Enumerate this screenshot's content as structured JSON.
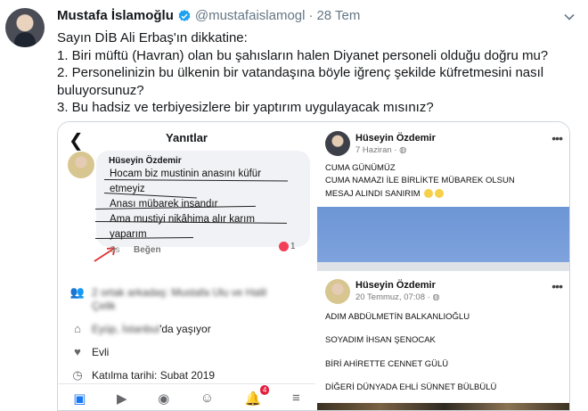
{
  "tweet": {
    "author_name": "Mustafa İslamoğlu",
    "handle": "@mustafaislamogl",
    "separator": "·",
    "date": "28 Tem",
    "lines": [
      "Sayın DİB Ali Erbaş'ın dikkatine:",
      "1. Biri müftü (Havran) olan bu şahısların halen Diyanet personeli olduğu doğru mu?",
      "2. Personelinizin bu ülkenin bir vatandaşına böyle iğrenç şekilde küfretmesini nasıl buluyorsunuz?",
      "3. Bu hadsiz ve terbiyesizlere bir yaptırım uygulayacak mısınız?"
    ]
  },
  "left_screenshot": {
    "back_glyph": "❮",
    "title": "Yanıtlar",
    "comment": {
      "name": "Hüseyin Özdemir",
      "lines": [
        "Hocam biz mustinin anasını küfür",
        "etmeyiz",
        "Anası mübarek insandır",
        "Ama mustiyi nikâhima alır karım",
        "yaparım"
      ],
      "time": "9s",
      "like": "Beğen",
      "reaction_count": "1"
    },
    "info": {
      "mutual_friends": "2 ortak arkadaş: Mustafa Ulu ve Halil",
      "mutual_friends_cont": "Çelik",
      "location_blurred": "Eyüp, İstanbul",
      "location_suffix": "'da yaşıyor",
      "relationship": "Evli",
      "joined": "Katılma tarihi: Subat 2019"
    },
    "nav_badge": "4"
  },
  "right_screenshot": {
    "post1": {
      "name": "Hüseyin Özdemir",
      "date": "7 Haziran · ",
      "more": "•••",
      "lines": [
        "CUMA GÜNÜMÜZ",
        "CUMA NAMAZI İLE BİRLİKTE MÜBAREK OLSUN",
        "MESAJ ALINDI SANIRIM"
      ]
    },
    "post2": {
      "name": "Hüseyin Özdemir",
      "date": "20 Temmuz, 07:08 · ",
      "more": "•••",
      "lines": [
        "ADIM ABDÜLMETİN BALKANLIOĞLU",
        "SOYADIM İHSAN ŞENOCAK",
        "BİRİ AHİRETTE CENNET GÜLÜ",
        "DİĞERİ DÜNYADA  EHLİ SÜNNET BÜLBÜLÜ"
      ]
    }
  },
  "colors": {
    "verified": "#1da1f2",
    "secondary_text": "#657786",
    "reaction": "#f33e58",
    "fb_blue": "#1877f2"
  },
  "icons": [
    "verified-badge-icon",
    "chevron-down-icon",
    "back-arrow-icon",
    "friends-icon",
    "home-location-icon",
    "heart-icon",
    "clock-icon",
    "more-icon"
  ]
}
